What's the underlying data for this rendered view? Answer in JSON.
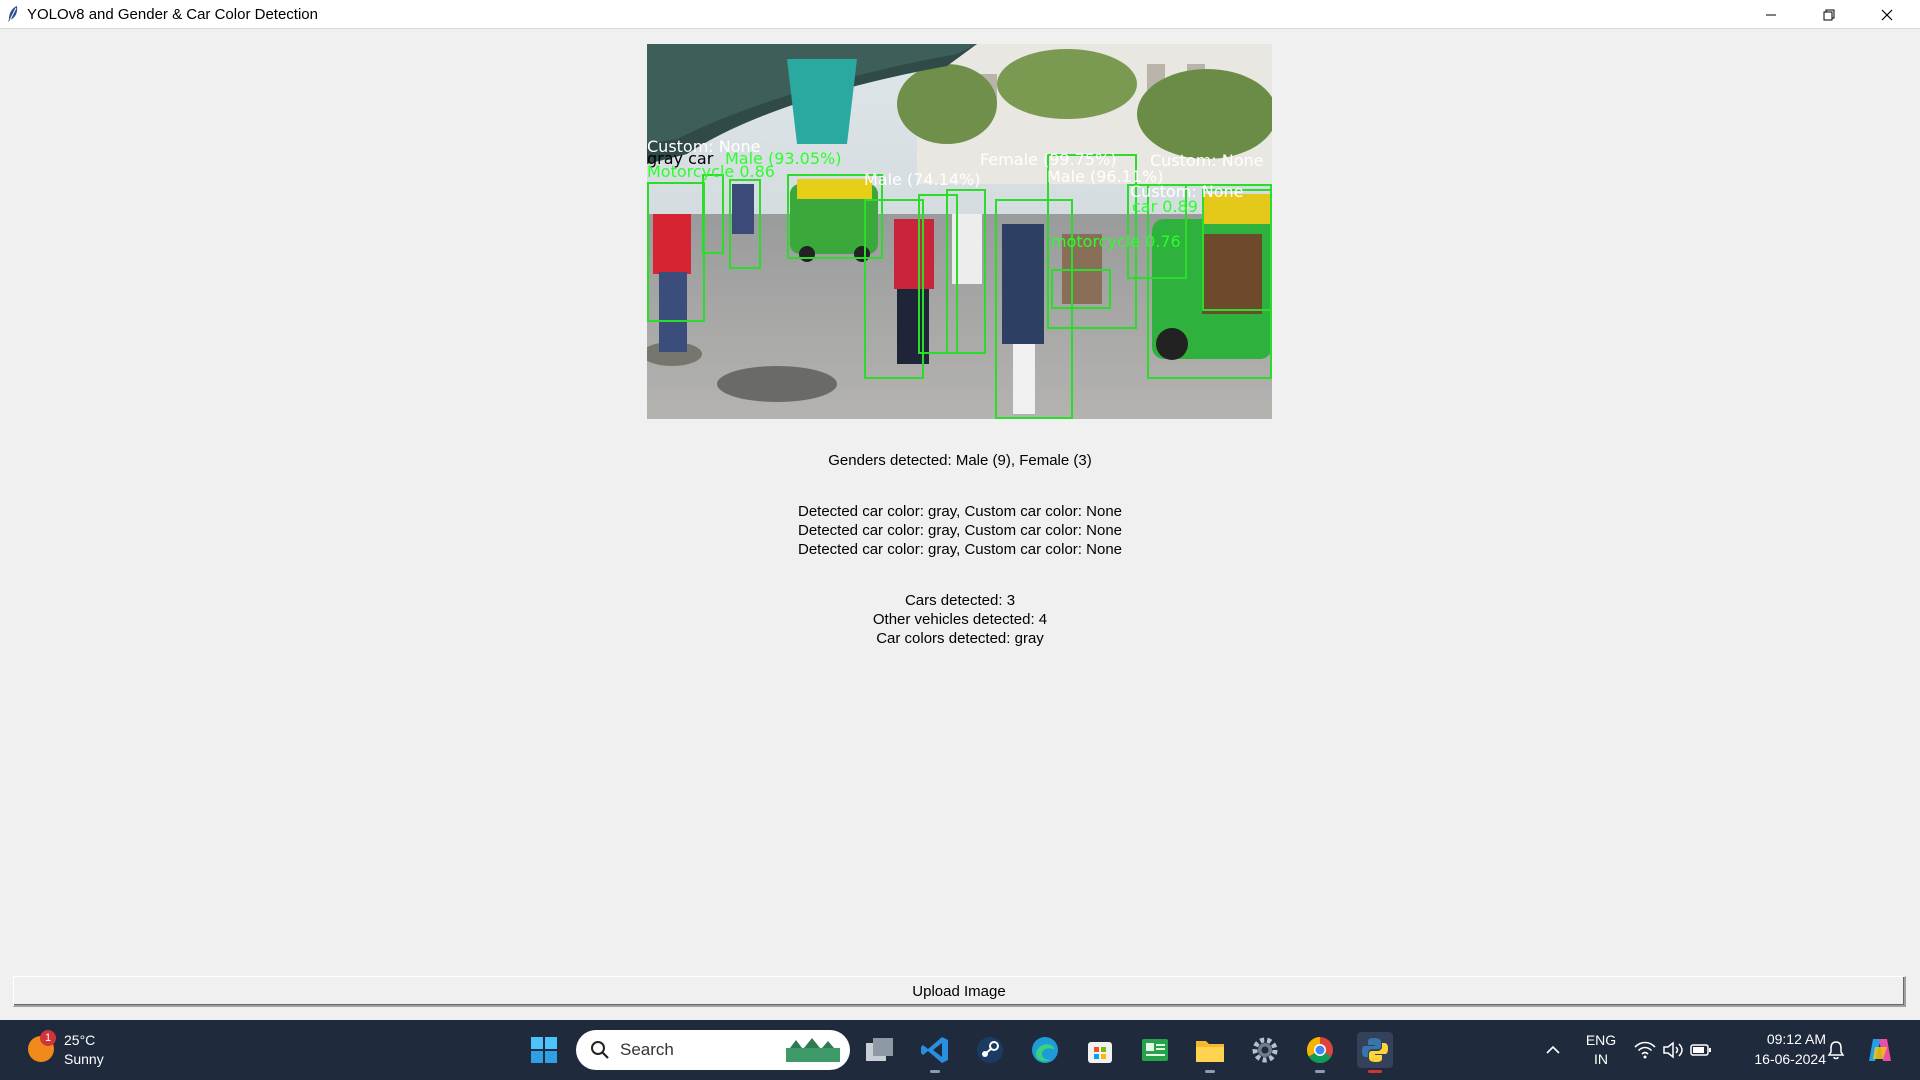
{
  "window": {
    "title": "YOLOv8 and Gender & Car Color Detection"
  },
  "detection_image": {
    "labels": {
      "custom_top": "Custom: None",
      "gray_car": "gray car",
      "motorcycle_left": "Motorcycle 0.86",
      "male_top": "Male (93.05%)",
      "male_mid": "Male (74.14%)",
      "female_top": "Female (99.75%)",
      "male_right": "Male (96.11%)",
      "custom_right": "Custom: None",
      "custom_mid": "Custom: None",
      "motorcycle_mid": "motorcycle 0.76",
      "car_conf": "car 0.89"
    }
  },
  "results": {
    "genders": "Genders detected: Male (9), Female (3)",
    "car_color_lines": [
      "Detected car color: gray, Custom car color: None",
      "Detected car color: gray, Custom car color: None",
      "Detected car color: gray, Custom car color: None"
    ],
    "summary_lines": [
      "Cars detected: 3",
      "Other vehicles detected: 4",
      "Car colors detected: gray"
    ]
  },
  "upload_button": {
    "label": "Upload Image"
  },
  "taskbar": {
    "weather": {
      "temp": "25°C",
      "condition": "Sunny",
      "badge": "1"
    },
    "search": {
      "placeholder": "Search"
    },
    "tray": {
      "lang_top": "ENG",
      "lang_bottom": "IN"
    },
    "clock": {
      "time": "09:12 AM",
      "date": "16-06-2024"
    },
    "icons": [
      "start-icon",
      "task-view-icon",
      "vscode-icon",
      "steam-icon",
      "edge-icon",
      "store-icon",
      "app-green-icon",
      "file-explorer-icon",
      "settings-icon",
      "chrome-icon",
      "python-icon"
    ]
  },
  "colors": {
    "detection_box": "#2bdc2b",
    "taskbar_bg": "#1f2a3c",
    "window_bg": "#f0f0f0"
  }
}
